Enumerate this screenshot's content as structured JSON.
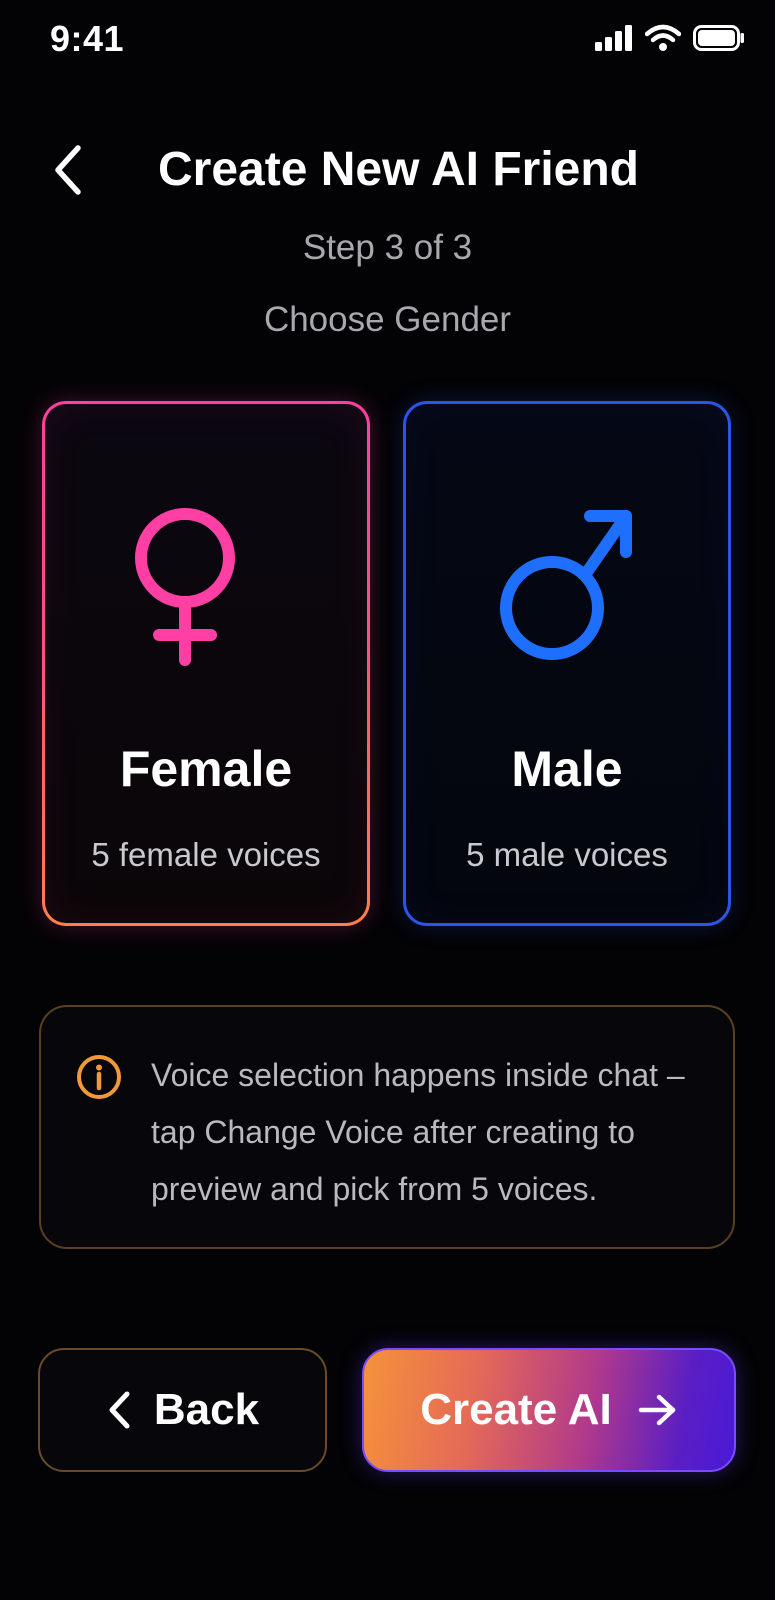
{
  "status_bar": {
    "time": "9:41"
  },
  "header": {
    "title": "Create New AI Friend",
    "step": "Step 3 of 3",
    "subtitle": "Choose Gender"
  },
  "options": [
    {
      "label": "Female",
      "description": "5 female voices",
      "icon": "female-symbol-icon",
      "color": "#ff3fa3"
    },
    {
      "label": "Male",
      "description": "5 male voices",
      "icon": "male-symbol-icon",
      "color": "#1f6fff"
    }
  ],
  "info": {
    "icon": "info-icon",
    "color": "#f29a3a",
    "text": "Voice selection happens inside chat – tap Change Voice after creating to preview and pick from 5 voices."
  },
  "buttons": {
    "back_label": "Back",
    "create_label": "Create AI"
  }
}
